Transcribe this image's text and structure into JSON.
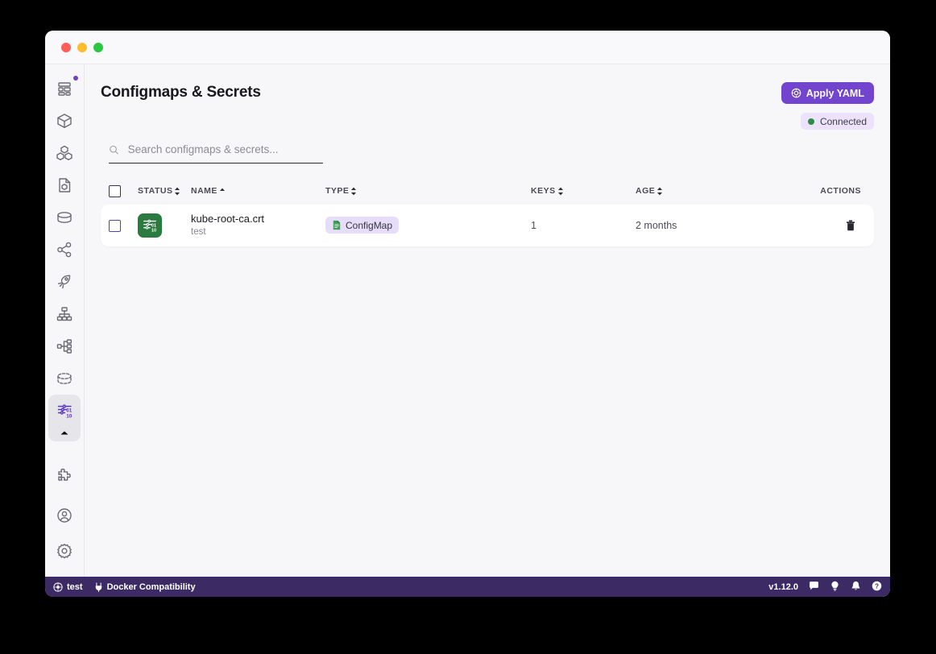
{
  "window": {
    "traffic_lights": [
      "close",
      "minimize",
      "maximize"
    ]
  },
  "sidebar": {
    "items": [
      {
        "name": "dashboard",
        "icon": "dashboard-icon",
        "badge": true
      },
      {
        "name": "pods",
        "icon": "cube-icon",
        "badge": false
      },
      {
        "name": "deployments",
        "icon": "cubes-icon",
        "badge": false
      },
      {
        "name": "manifests",
        "icon": "file-cube-icon",
        "badge": false
      },
      {
        "name": "storage",
        "icon": "database-icon",
        "badge": false
      },
      {
        "name": "services",
        "icon": "share-network-icon",
        "badge": false
      },
      {
        "name": "jobs",
        "icon": "rocket-icon",
        "badge": false
      },
      {
        "name": "topology",
        "icon": "sitemap-icon",
        "badge": false
      },
      {
        "name": "workflows",
        "icon": "branch-icon",
        "badge": false
      },
      {
        "name": "volumes",
        "icon": "dashed-database-icon",
        "badge": false
      },
      {
        "name": "configmaps-secrets",
        "icon": "config-binary-icon",
        "badge": false,
        "active": true
      },
      {
        "name": "plugins",
        "icon": "puzzle-icon",
        "badge": false
      }
    ],
    "bottom_items": [
      {
        "name": "account",
        "icon": "user-circle-icon"
      },
      {
        "name": "settings",
        "icon": "gear-icon"
      }
    ],
    "collapse_icon": "chevron-up-icon"
  },
  "header": {
    "title": "Configmaps & Secrets",
    "apply_button": {
      "label": "Apply YAML",
      "icon": "apply-icon"
    },
    "connection": {
      "label": "Connected",
      "status_color": "#2f8b45"
    }
  },
  "search": {
    "placeholder": "Search configmaps & secrets...",
    "value": "",
    "icon": "search-icon"
  },
  "table": {
    "columns": [
      {
        "key": "select",
        "label": ""
      },
      {
        "key": "status",
        "label": "STATUS",
        "sortable": true
      },
      {
        "key": "name",
        "label": "NAME",
        "sortable": true,
        "sorted": "asc"
      },
      {
        "key": "type",
        "label": "TYPE",
        "sortable": true
      },
      {
        "key": "keys",
        "label": "KEYS",
        "sortable": true
      },
      {
        "key": "age",
        "label": "AGE",
        "sortable": true
      },
      {
        "key": "actions",
        "label": "ACTIONS",
        "sortable": false
      }
    ],
    "rows": [
      {
        "selected": false,
        "status_icon": "configmap-binary-icon",
        "status_color": "#2b7a3f",
        "name": "kube-root-ca.crt",
        "namespace": "test",
        "type": "ConfigMap",
        "type_icon": "file-icon",
        "keys": "1",
        "age": "2 months",
        "action_icon": "trash-icon"
      }
    ]
  },
  "footer": {
    "context": {
      "label": "test",
      "icon": "cluster-icon"
    },
    "compatibility": {
      "label": "Docker Compatibility",
      "icon": "plug-icon"
    },
    "version": "v1.12.0",
    "icons": [
      "chat-icon",
      "lightbulb-icon",
      "bell-icon",
      "help-icon"
    ]
  },
  "colors": {
    "accent": "#7345ce",
    "footer_bg": "#3b2a63",
    "badge_bg": "#e6ddfa",
    "status_green": "#2b7a3f"
  }
}
